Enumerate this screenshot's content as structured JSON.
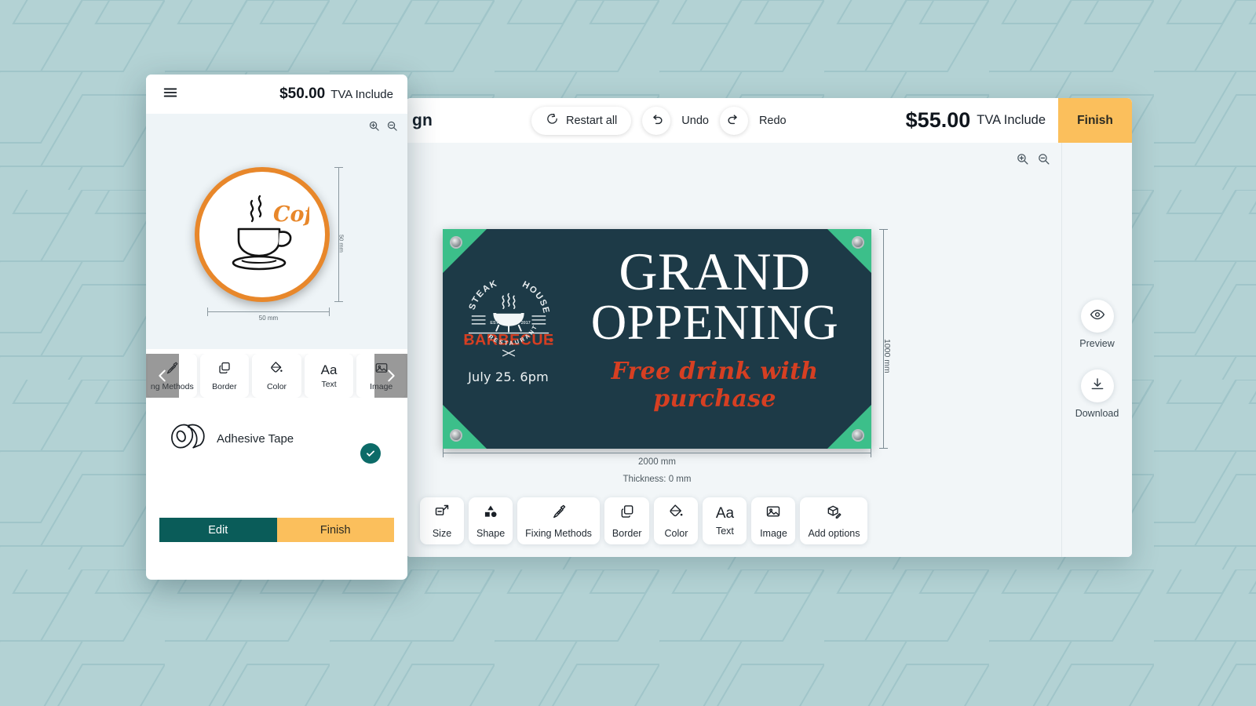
{
  "background": {
    "color": "#b3d2d4",
    "pattern": "rhombus-outline-tiling",
    "pattern_color": "#a2c6c9"
  },
  "editor": {
    "title": "gn",
    "toolbar": {
      "restart_all": "Restart all",
      "undo": "Undo",
      "redo": "Redo"
    },
    "price": "$55.00",
    "tva": "TVA Include",
    "finish_label": "Finish",
    "zoom_in_icon": "zoom-in-icon",
    "zoom_out_icon": "zoom-out-icon"
  },
  "artwork": {
    "headline_line1": "GRAND",
    "headline_line2": "OPPENING",
    "subline": "Free drink with purchase",
    "date": "July 25. 6pm",
    "logo": {
      "arc_top_left": "STEAK",
      "arc_top_right": "HOUSE",
      "main": "BARBECUE",
      "arc_bottom": "RESTAURANT",
      "est_left": "EST",
      "est_right": "2017"
    },
    "colors": {
      "background": "#1d3a47",
      "corner": "#3cbf8a",
      "headline": "#ffffff",
      "accent_red": "#d63f22"
    }
  },
  "dimensions": {
    "width_label": "2000 mm",
    "height_label": "1000 mm",
    "thickness_label": "Thickness: 0 mm"
  },
  "bottom_toolbar": [
    {
      "label": "Size",
      "icon": "resize-icon"
    },
    {
      "label": "Shape",
      "icon": "shapes-icon"
    },
    {
      "label": "Fixing Methods",
      "icon": "screw-icon"
    },
    {
      "label": "Border",
      "icon": "layers-icon"
    },
    {
      "label": "Color",
      "icon": "paint-bucket-icon"
    },
    {
      "label": "Text",
      "icon": "text-aa-icon"
    },
    {
      "label": "Image",
      "icon": "image-icon"
    },
    {
      "label": "Add options",
      "icon": "box-edit-icon"
    }
  ],
  "right_rail": [
    {
      "label": "Preview",
      "icon": "eye-icon"
    },
    {
      "label": "Download",
      "icon": "download-icon"
    }
  ],
  "mobile_panel": {
    "menu_icon": "hamburger-menu-icon",
    "price": "$50.00",
    "tva": "TVA Include",
    "zoom_in_icon": "zoom-in-icon",
    "zoom_out_icon": "zoom-out-icon",
    "sticker": {
      "text": "Coff",
      "border_color": "#e8872a",
      "icon": "coffee-cup-icon"
    },
    "dimensions": {
      "width_label": "50 mm",
      "height_label": "50 mm"
    },
    "tools": [
      {
        "label": "ng Methods",
        "icon": "screw-icon"
      },
      {
        "label": "Border",
        "icon": "layers-icon"
      },
      {
        "label": "Color",
        "icon": "paint-bucket-icon"
      },
      {
        "label": "Text",
        "icon": "text-aa-icon"
      },
      {
        "label": "Image",
        "icon": "image-icon"
      }
    ],
    "scroll_left_icon": "chevron-left-icon",
    "scroll_right_icon": "chevron-right-icon",
    "option": {
      "label": "Adhesive Tape",
      "icon": "adhesive-tape-icon",
      "selected_icon": "check-circle-icon",
      "selected_color": "#0c6b68"
    },
    "edit_label": "Edit",
    "finish_label": "Finish"
  }
}
